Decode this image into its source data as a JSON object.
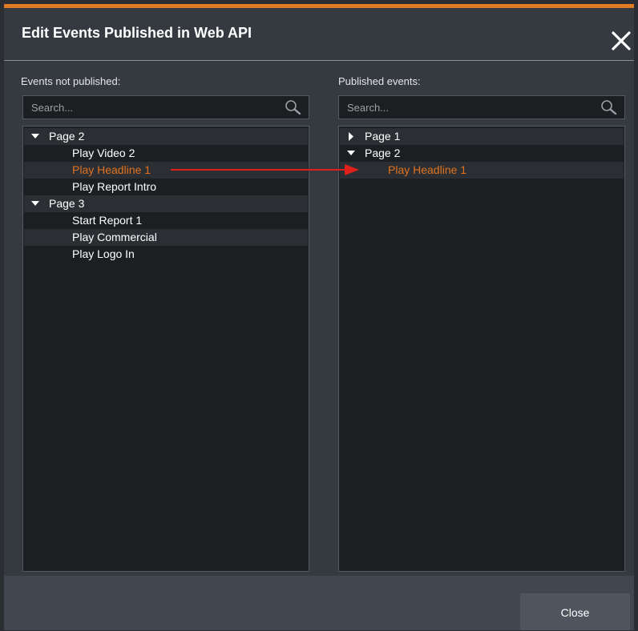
{
  "dialog": {
    "title": "Edit Events Published in Web API",
    "accent_color": "#e07a23",
    "close_icon": "close-icon"
  },
  "left_panel": {
    "label": "Events not published:",
    "search_placeholder": "Search...",
    "tree": [
      {
        "type": "group",
        "label": "Page 2",
        "expanded": true
      },
      {
        "type": "item",
        "label": "Play Video 2"
      },
      {
        "type": "item",
        "label": "Play Headline 1",
        "selected": true
      },
      {
        "type": "item",
        "label": "Play Report Intro"
      },
      {
        "type": "group",
        "label": "Page 3",
        "expanded": true
      },
      {
        "type": "item",
        "label": "Start Report 1"
      },
      {
        "type": "item",
        "label": "Play Commercial"
      },
      {
        "type": "item",
        "label": "Play Logo In"
      }
    ]
  },
  "right_panel": {
    "label": "Published events:",
    "search_placeholder": "Search...",
    "tree": [
      {
        "type": "group",
        "label": "Page 1",
        "expanded": false
      },
      {
        "type": "group",
        "label": "Page 2",
        "expanded": true
      },
      {
        "type": "item",
        "label": "Play Headline 1",
        "selected": true
      }
    ]
  },
  "footer": {
    "close_label": "Close"
  },
  "colors": {
    "selected_text": "#e2721f",
    "annotation_arrow": "#e0201c"
  }
}
